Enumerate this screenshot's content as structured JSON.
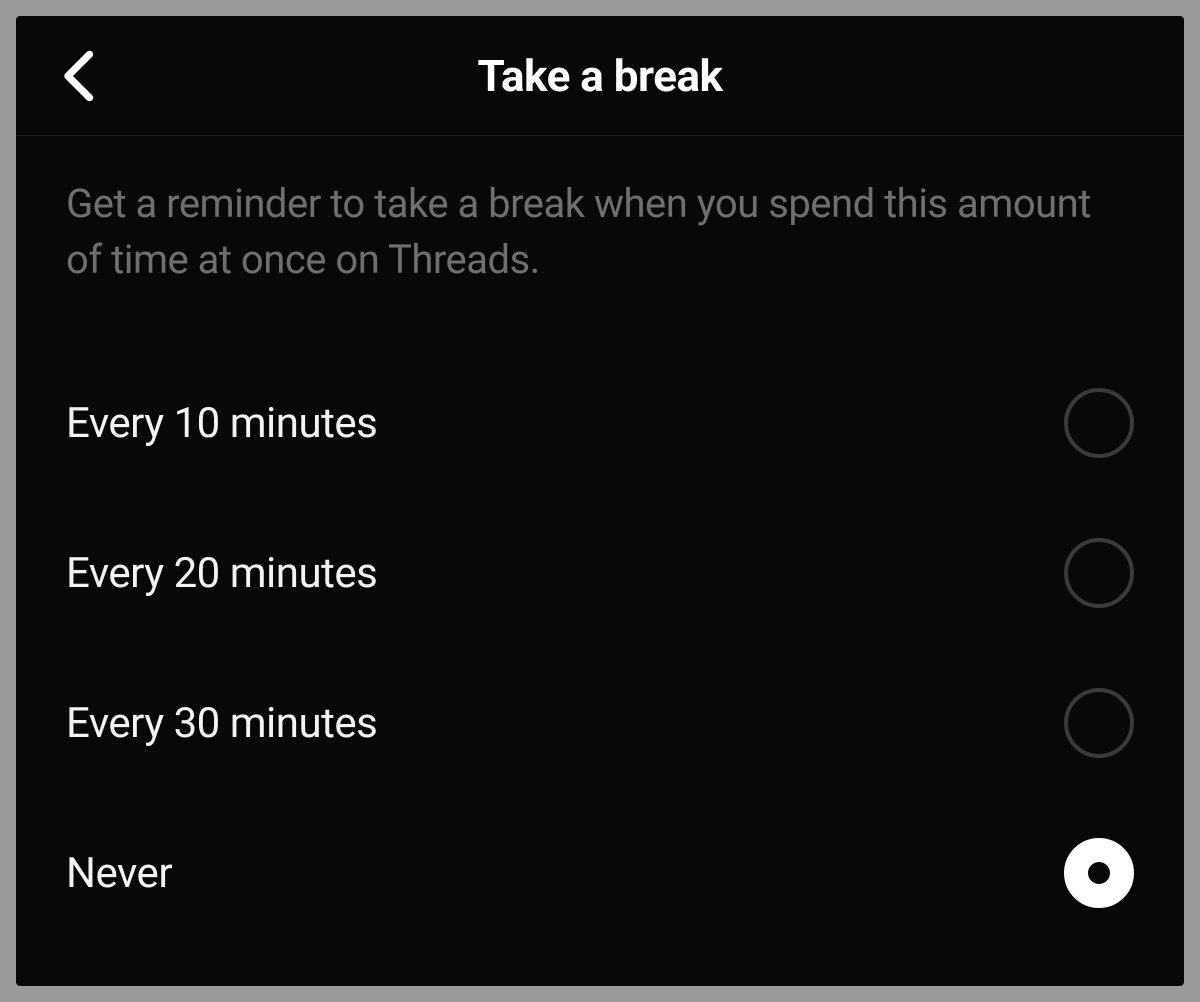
{
  "header": {
    "title": "Take a break"
  },
  "description": "Get a reminder to take a break when you spend this amount of time at once on Threads.",
  "options": [
    {
      "label": "Every 10 minutes",
      "selected": false
    },
    {
      "label": "Every 20 minutes",
      "selected": false
    },
    {
      "label": "Every 30 minutes",
      "selected": false
    },
    {
      "label": "Never",
      "selected": true
    }
  ]
}
